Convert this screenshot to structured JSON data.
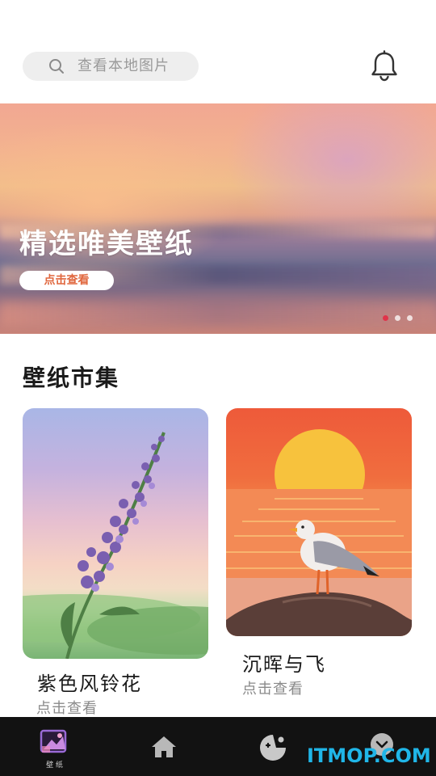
{
  "search": {
    "placeholder": "查看本地图片"
  },
  "banner": {
    "title": "精选唯美壁纸",
    "button_label": "点击查看",
    "dots": 3,
    "active_dot": 0,
    "active_dot_color": "#e0344a"
  },
  "section": {
    "title": "壁纸市集"
  },
  "cards": [
    {
      "title": "紫色风铃花",
      "subtitle": "点击查看",
      "image": "lavender-flower-image"
    },
    {
      "title": "沉晖与飞",
      "subtitle": "点击查看",
      "image": "sunset-seagull-image"
    }
  ],
  "tabbar": {
    "items": [
      {
        "icon": "wallpaper-icon",
        "label": "壁 纸",
        "active": true
      },
      {
        "icon": "home-icon",
        "label": "",
        "active": false
      },
      {
        "icon": "game-icon",
        "label": "",
        "active": false
      },
      {
        "icon": "profile-icon",
        "label": "",
        "active": false
      }
    ]
  },
  "watermark": "ITMOP.COM",
  "colors": {
    "accent": "#e0673e",
    "tabbar_bg": "#121212",
    "watermark": "#20b6e8"
  }
}
